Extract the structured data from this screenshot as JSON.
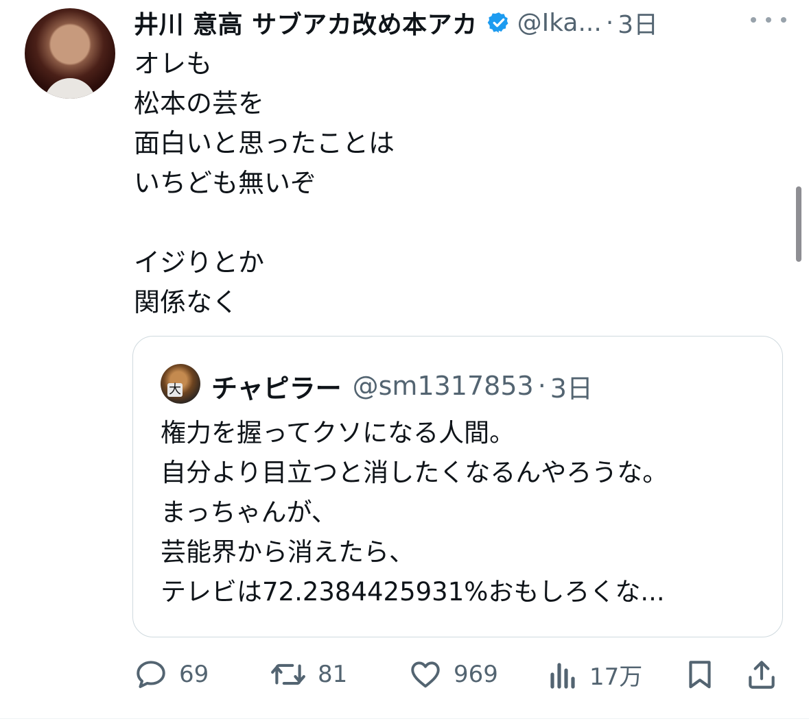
{
  "tweet": {
    "author_name": "井川 意高 サブアカ改め本アカ",
    "handle": "@Ika...",
    "separator": "·",
    "time": "3日",
    "lines": [
      "オレも",
      "松本の芸を",
      "面白いと思ったことは",
      "いちども無いぞ",
      "",
      "イジりとか",
      "関係なく"
    ]
  },
  "quote": {
    "author_name": "チャピラー",
    "avatar_text": "大",
    "handle": "@sm1317853",
    "separator": "·",
    "time": "3日",
    "lines": [
      "権力を握ってクソになる人間。",
      "自分より目立つと消したくなるんやろうな。",
      "まっちゃんが、",
      "芸能界から消えたら、",
      "テレビは72.2384425931%おもしろくな..."
    ]
  },
  "actions": {
    "replies": "69",
    "retweets": "81",
    "likes": "969",
    "views": "17万"
  },
  "colors": {
    "text": "#0f1419",
    "secondary": "#536471",
    "verified": "#1d9bf0",
    "border": "#cfd9de"
  }
}
